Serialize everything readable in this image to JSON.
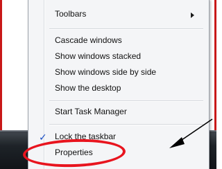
{
  "context_menu": {
    "items": [
      {
        "label": "Toolbars",
        "has_submenu": true
      },
      {
        "label": "Cascade windows"
      },
      {
        "label": "Show windows stacked"
      },
      {
        "label": "Show windows side by side"
      },
      {
        "label": "Show the desktop"
      },
      {
        "label": "Start Task Manager"
      },
      {
        "label": "Lock the taskbar",
        "checked": true
      },
      {
        "label": "Properties",
        "highlighted_by_annotation": true
      }
    ]
  },
  "annotations": {
    "oval_color": "#e8141e",
    "arrow_color": "#000000"
  },
  "colors": {
    "frame_border": "#c81818",
    "menu_background": "#f4f5f7",
    "taskbar": "#1e2328"
  }
}
